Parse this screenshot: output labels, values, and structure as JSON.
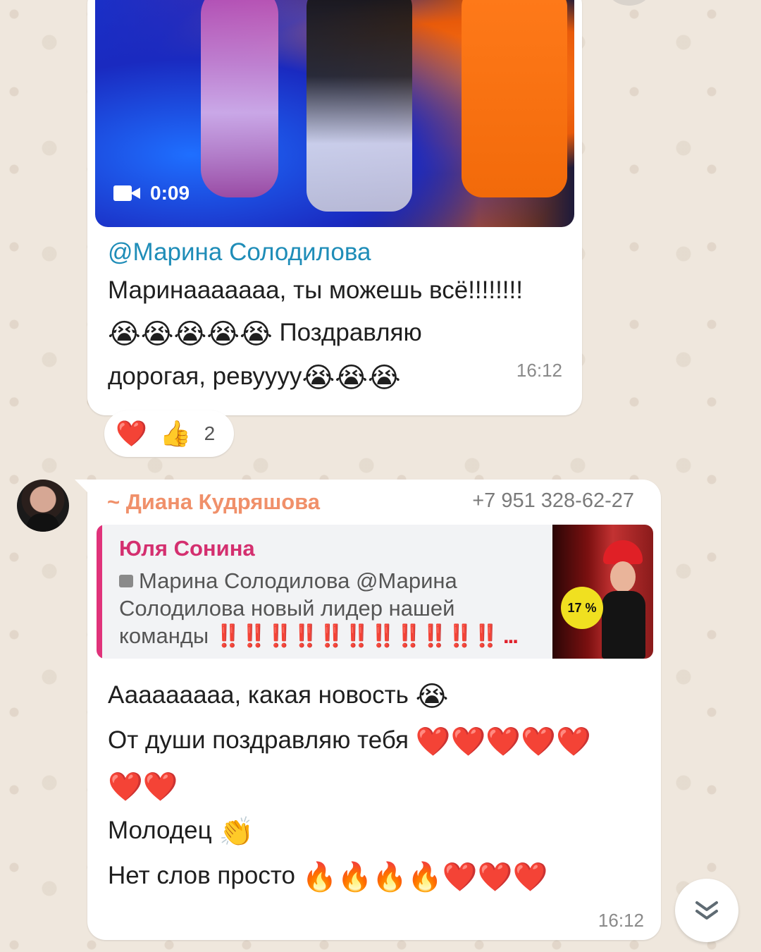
{
  "message1": {
    "video_duration": "0:09",
    "mention": "@Марина Солодилова",
    "lines": [
      "Маринааааааа, ты можешь всё!!!!!!!!",
      "Поздравляю",
      "дорогая, ревуууу"
    ],
    "emoji_line2": "😭😭😭😭😭",
    "emoji_line3": "😭😭😭",
    "time": "16:12",
    "reactions": {
      "emoji": [
        "❤️",
        "👍"
      ],
      "count": "2"
    }
  },
  "message2": {
    "sender": "~ Диана Кудряшова",
    "phone": "+7 951 328-62-27",
    "reply": {
      "author": "Юля Сонина",
      "text": "Марина Солодилова @Марина Солодилова новый лидер нашей команды",
      "bangs": "‼️‼️‼️‼️‼️‼️‼️‼️‼️‼️‼️ ...",
      "thumb_badge": "17 %"
    },
    "lines": [
      {
        "text": "Ааааааааа, какая новость",
        "emoji": "😭"
      },
      {
        "text": "От души поздравляю тебя",
        "emoji": "❤️❤️❤️❤️❤️"
      },
      {
        "text": "",
        "emoji": "❤️❤️"
      },
      {
        "text": "Молодец",
        "emoji": "👏"
      },
      {
        "text": "Нет слов просто",
        "emoji": "🔥🔥🔥🔥❤️❤️❤️"
      }
    ],
    "time": "16:12"
  },
  "colors": {
    "mention": "#1f8db8",
    "sender": "#f0906a",
    "reply_author": "#d42f6f",
    "background": "#efe7dd"
  }
}
